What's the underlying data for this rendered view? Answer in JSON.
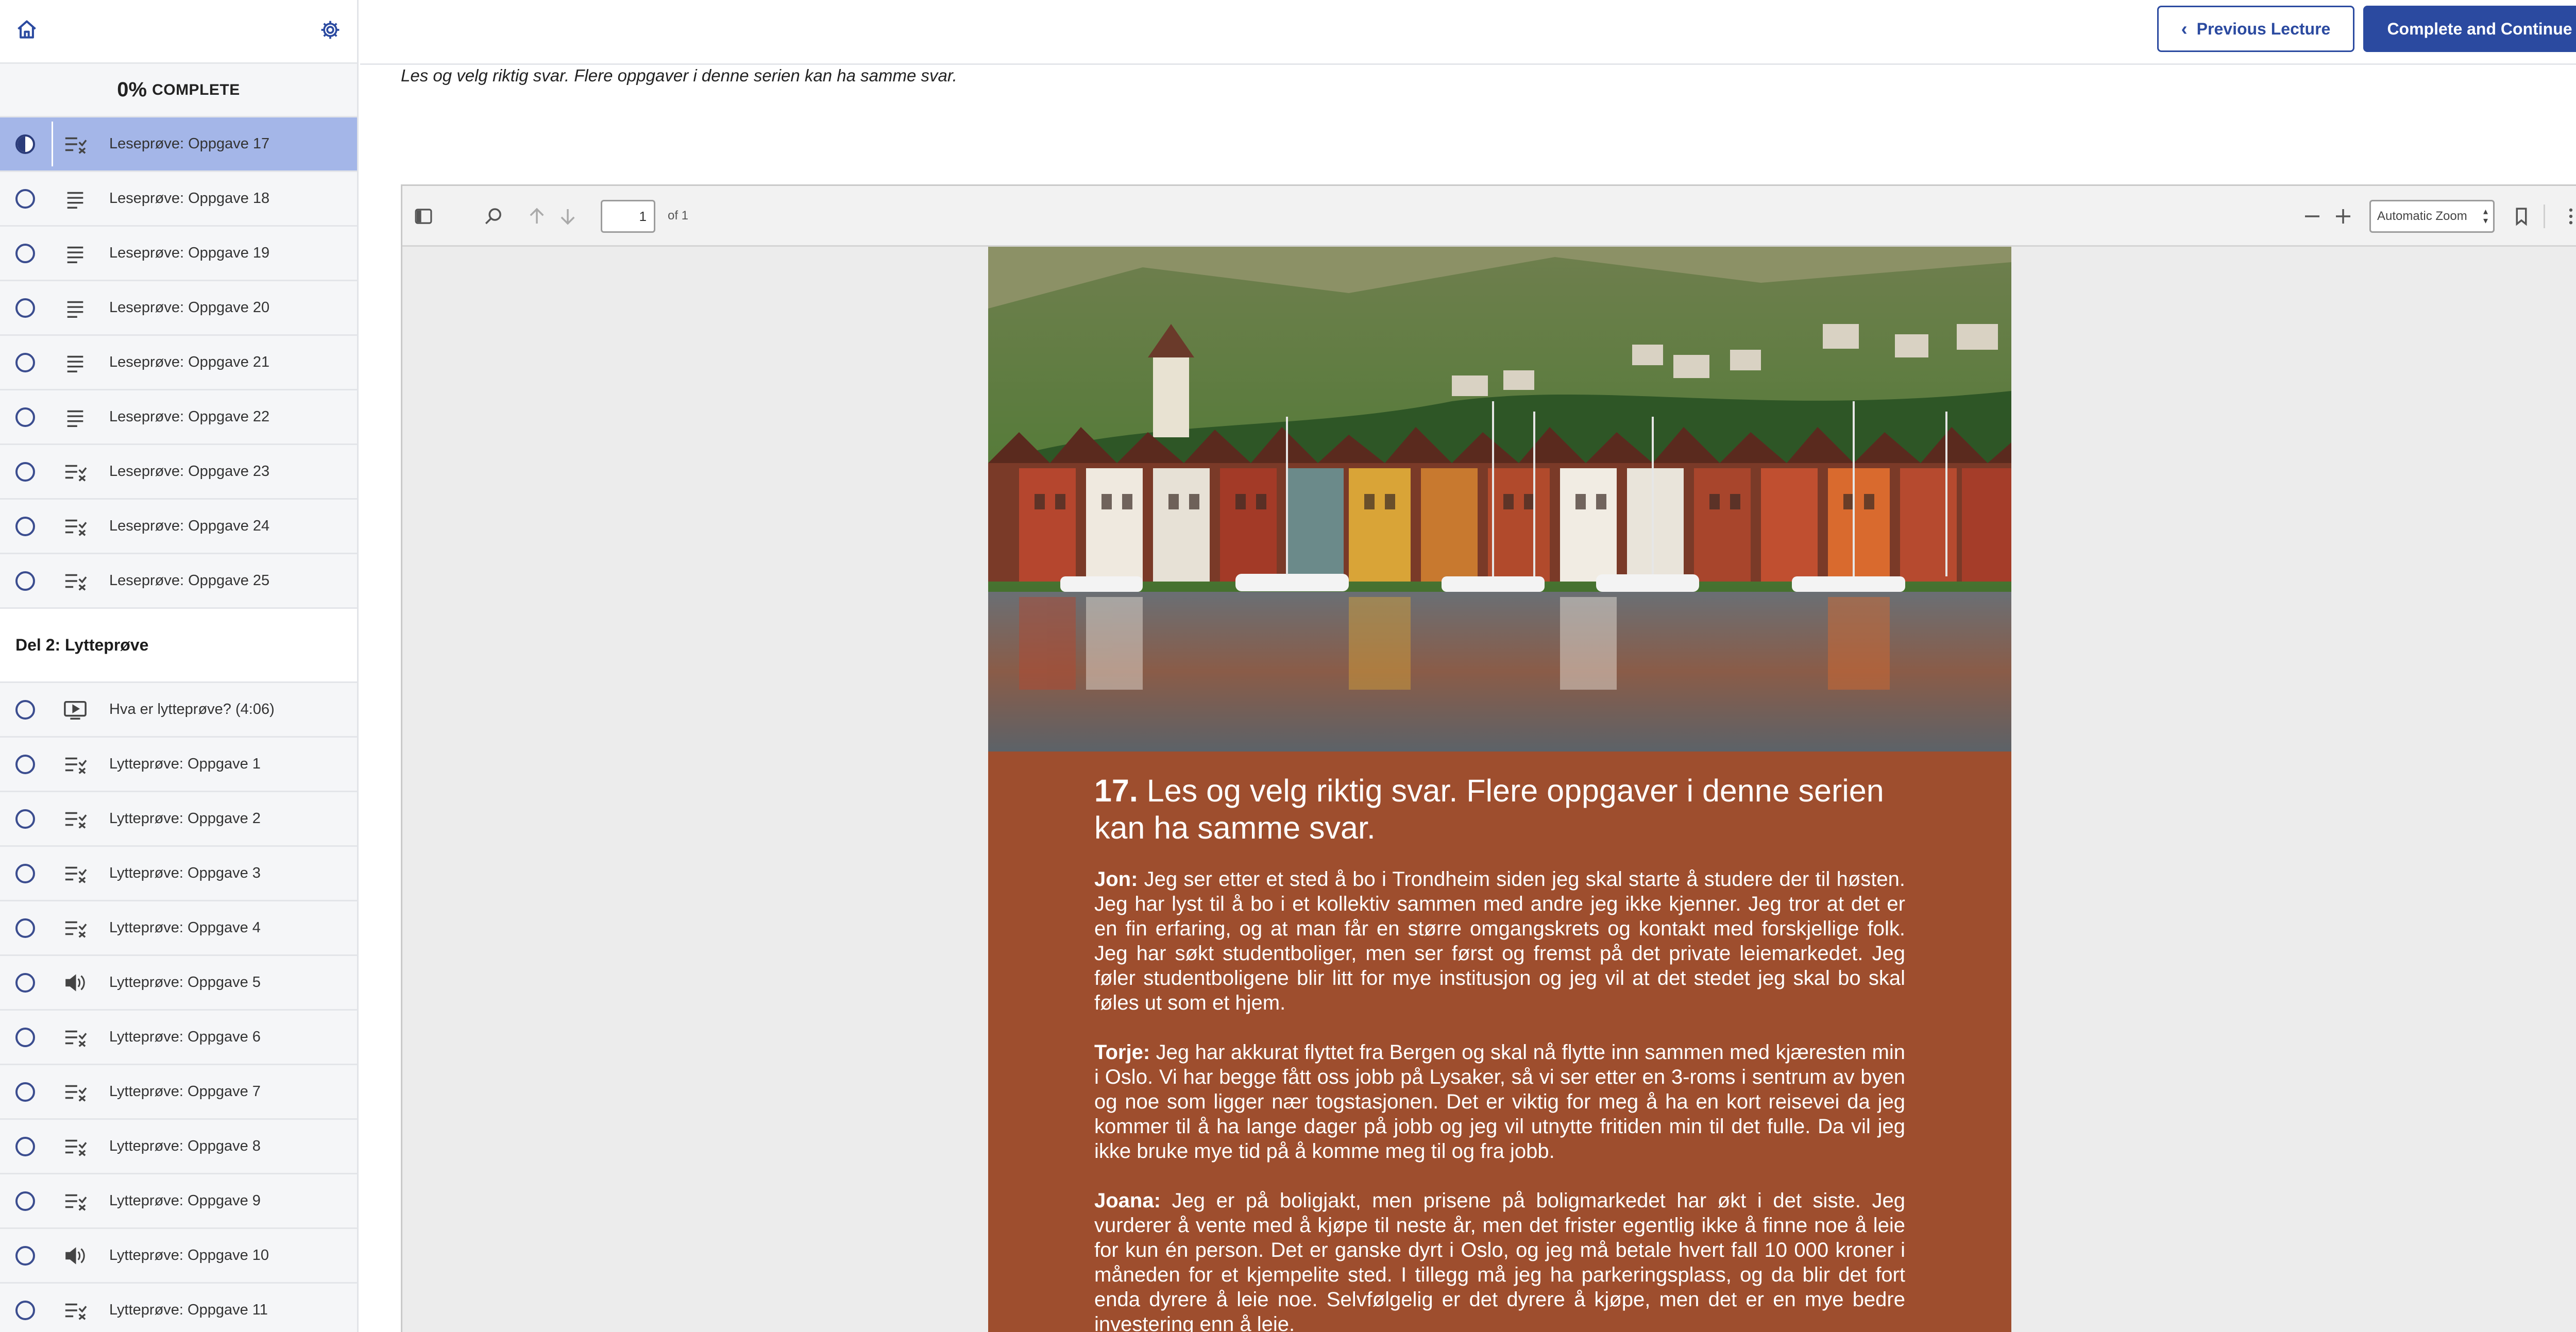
{
  "sidebar": {
    "progress": {
      "percent": "0%",
      "label": "COMPLETE"
    },
    "lessons_section1": [
      {
        "title": "Leseprøve: Oppgave 17",
        "type": "quiz",
        "active": true
      },
      {
        "title": "Leseprøve: Oppgave 18",
        "type": "text"
      },
      {
        "title": "Leseprøve: Oppgave 19",
        "type": "text"
      },
      {
        "title": "Leseprøve: Oppgave 20",
        "type": "text"
      },
      {
        "title": "Leseprøve: Oppgave 21",
        "type": "text"
      },
      {
        "title": "Leseprøve: Oppgave 22",
        "type": "text"
      },
      {
        "title": "Leseprøve: Oppgave 23",
        "type": "quiz"
      },
      {
        "title": "Leseprøve: Oppgave 24",
        "type": "quiz"
      },
      {
        "title": "Leseprøve: Oppgave 25",
        "type": "quiz"
      }
    ],
    "section2_title": "Del 2: Lytteprøve",
    "lessons_section2": [
      {
        "title": "Hva er lytteprøve? (4:06)",
        "type": "video"
      },
      {
        "title": "Lytteprøve: Oppgave 1",
        "type": "quiz"
      },
      {
        "title": "Lytteprøve: Oppgave 2",
        "type": "quiz"
      },
      {
        "title": "Lytteprøve: Oppgave 3",
        "type": "quiz"
      },
      {
        "title": "Lytteprøve: Oppgave 4",
        "type": "quiz"
      },
      {
        "title": "Lytteprøve: Oppgave 5",
        "type": "audio"
      },
      {
        "title": "Lytteprøve: Oppgave 6",
        "type": "quiz"
      },
      {
        "title": "Lytteprøve: Oppgave 7",
        "type": "quiz"
      },
      {
        "title": "Lytteprøve: Oppgave 8",
        "type": "quiz"
      },
      {
        "title": "Lytteprøve: Oppgave 9",
        "type": "quiz"
      },
      {
        "title": "Lytteprøve: Oppgave 10",
        "type": "audio"
      },
      {
        "title": "Lytteprøve: Oppgave 11",
        "type": "quiz"
      }
    ]
  },
  "topbar": {
    "prev_label": "Previous Lecture",
    "next_label": "Complete and Continue"
  },
  "main": {
    "instruction": "Les og velg riktig svar. Flere oppgaver i denne serien kan ha samme svar."
  },
  "pdf_viewer": {
    "page_number": "1",
    "page_count": "of 1",
    "zoom": "Automatic Zoom",
    "article": {
      "number": "17.",
      "title": "Les og velg riktig svar. Flere oppgaver i denne serien kan ha samme svar.",
      "paragraphs": [
        {
          "speaker": "Jon:",
          "text": "Jeg ser etter et sted å bo i Trondheim siden jeg skal starte å studere der til høsten. Jeg har lyst til å bo i et kollektiv sammen med andre jeg ikke kjenner. Jeg tror at det er en fin erfaring, og at man får en større omgangskrets og kontakt med forskjellige folk. Jeg har søkt studentboliger, men ser først og fremst på det private leiemarkedet. Jeg føler studentboligene blir litt for mye institusjon og jeg vil at det stedet jeg skal bo skal føles ut som et hjem."
        },
        {
          "speaker": "Torje:",
          "text": "Jeg har akkurat flyttet fra Bergen og skal nå flytte inn sammen med kjæresten min i Oslo. Vi har begge fått oss jobb på Lysaker, så vi ser etter en 3-roms i sentrum av byen og noe som ligger nær togstasjonen. Det er viktig for meg å ha en kort reisevei da jeg kommer til å ha lange dager på jobb og jeg vil utnytte fritiden min til det fulle. Da vil jeg ikke bruke mye tid på å komme meg til og fra jobb."
        },
        {
          "speaker": "Joana:",
          "text": "Jeg er på boligjakt, men prisene på boligmarkedet har økt i det siste. Jeg vurderer å vente med å kjøpe til neste år, men det frister egentlig ikke å finne noe å leie for kun én person. Det er ganske dyrt i Oslo, og jeg må betale hvert fall 10 000 kroner i måneden for et kjempelite sted. I tillegg må jeg ha parkeringsplass, og da blir det fort enda dyrere å leie noe. Selvfølgelig er det dyrere å kjøpe, men det er en mye bedre investering enn å leie."
        }
      ]
    }
  },
  "colors": {
    "accent": "#2b4aa0",
    "active_row": "#a4b6e8",
    "article_bg": "#9e4e2e"
  }
}
